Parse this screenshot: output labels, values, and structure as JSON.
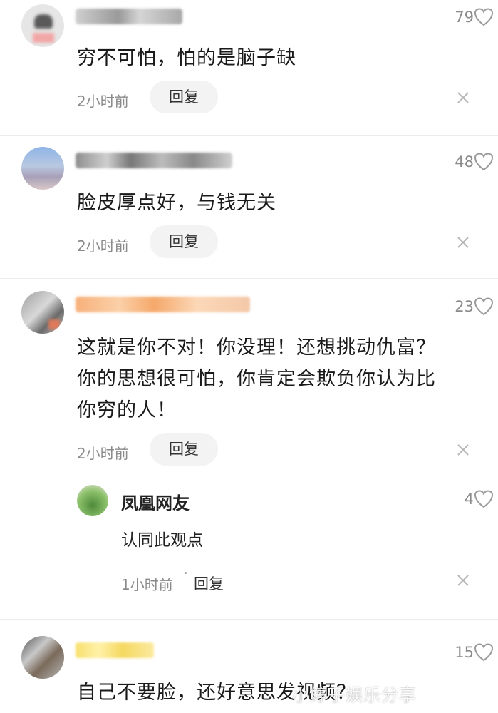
{
  "comments": [
    {
      "likes": "79",
      "text": "穷不可怕，怕的是脑子缺",
      "time": "2小时前",
      "reply_label": "回复"
    },
    {
      "likes": "48",
      "text": "脸皮厚点好，与钱无关",
      "time": "2小时前",
      "reply_label": "回复"
    },
    {
      "likes": "23",
      "text": "这就是你不对！你没理！还想挑动仇富？\n你的思想很可怕，你肯定会欺负你认为比\n你穷的人！",
      "time": "2小时前",
      "reply_label": "回复",
      "sub_reply": {
        "username": "凤凰网友",
        "likes": "4",
        "text": "认同此观点",
        "time": "1小时前",
        "reply_label": "回复"
      }
    },
    {
      "likes": "15",
      "text": "自己不要脸，还好意思发视频？"
    }
  ],
  "watermark": "小婷子娱乐分享",
  "icons": {
    "like": "heart-icon",
    "close": "close-icon"
  }
}
